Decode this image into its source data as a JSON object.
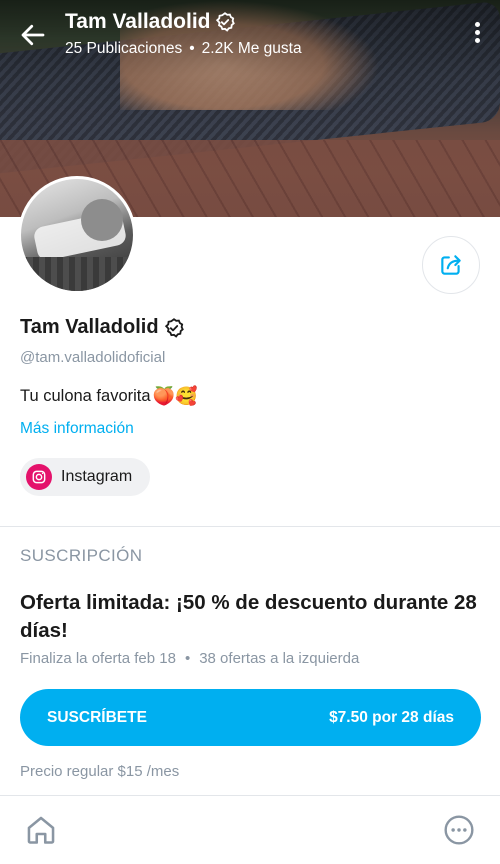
{
  "header": {
    "title": "Tam Valladolid",
    "posts": "25 Publicaciones",
    "likes": "2.2K Me gusta",
    "separator": "•"
  },
  "profile": {
    "name": "Tam Valladolid",
    "handle": "@tam.valladolidoficial",
    "bio": "Tu culona favorita",
    "bio_emoji": "🍑🥰",
    "more_info": "Más información",
    "social_link": "Instagram"
  },
  "subscription": {
    "section_label": "SUSCRIPCIÓN",
    "offer_title": "Oferta limitada: ¡50 % de descuento durante 28 días!",
    "offer_ends": "Finaliza la oferta feb 18",
    "separator": "•",
    "offers_left": "38 ofertas a la izquierda",
    "button_label": "SUSCRÍBETE",
    "button_price": "$7.50 por 28 días",
    "regular_price": "Precio regular $15 /mes"
  },
  "icons": {
    "back": "arrow-left-icon",
    "verified": "verified-badge-icon",
    "more": "vertical-dots-icon",
    "share": "share-icon",
    "instagram": "instagram-icon",
    "home": "home-icon",
    "menu": "more-horizontal-icon"
  },
  "colors": {
    "accent": "#00aff0",
    "instagram": "#e4126b",
    "muted": "#8a96a3"
  }
}
